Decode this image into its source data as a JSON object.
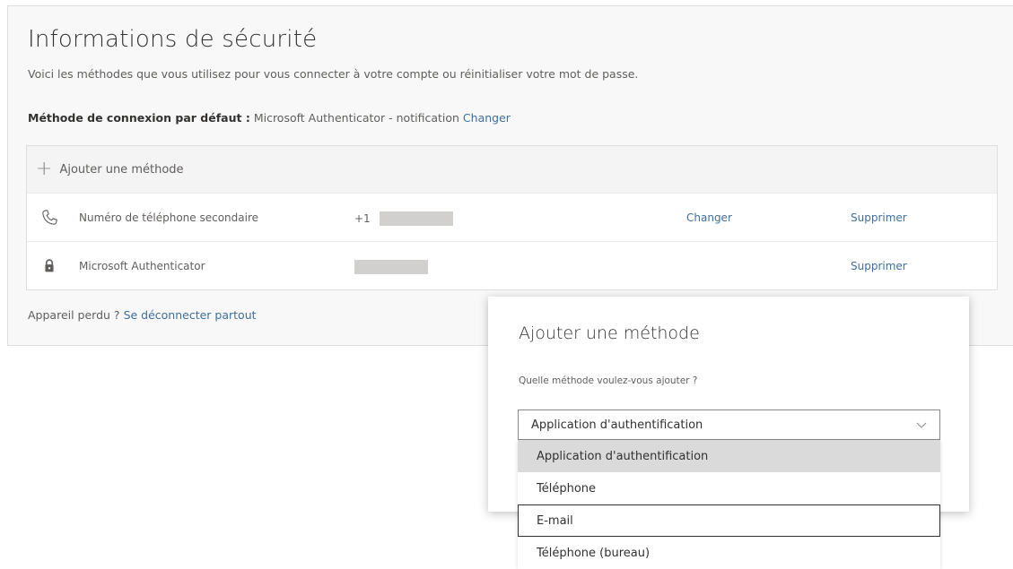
{
  "page": {
    "title": "Informations de sécurité",
    "subtitle": "Voici les méthodes que vous utilisez pour vous connecter à votre compte ou réinitialiser votre mot de passe."
  },
  "default_method": {
    "label": "Méthode de connexion par défaut :",
    "value": "Microsoft Authenticator - notification",
    "change_link": "Changer"
  },
  "methods": {
    "add_label": "Ajouter une méthode",
    "rows": [
      {
        "icon": "phone-icon",
        "name": "Numéro de téléphone secondaire",
        "value_prefix": "+1",
        "change": "Changer",
        "delete": "Supprimer"
      },
      {
        "icon": "lock-icon",
        "name": "Microsoft Authenticator",
        "value_prefix": "",
        "change": "",
        "delete": "Supprimer"
      }
    ]
  },
  "lost_device": {
    "text": "Appareil perdu ?",
    "link": "Se déconnecter partout"
  },
  "dialog": {
    "title": "Ajouter une méthode",
    "question": "Quelle méthode voulez-vous ajouter ?",
    "selected_value": "Application d'authentification",
    "options": [
      "Application d'authentification",
      "Téléphone",
      "E-mail",
      "Téléphone (bureau)"
    ],
    "selected_index": 0,
    "focused_index": 2
  },
  "colors": {
    "link": "#3e6e9b",
    "panel_bg": "#f8f8f8",
    "mask": "#d2d0ce"
  }
}
